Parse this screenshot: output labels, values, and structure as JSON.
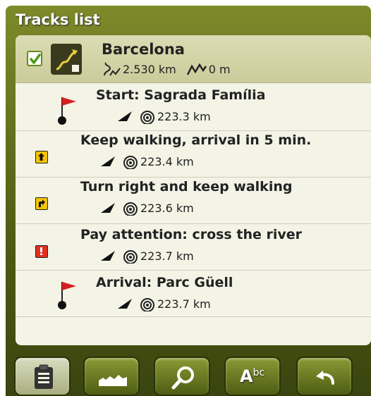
{
  "window": {
    "title": "Tracks list"
  },
  "track": {
    "name": "Barcelona",
    "checked": true,
    "distance": "2.530 km",
    "elevation": "0 m"
  },
  "waypoints": [
    {
      "title": "Start: Sagrada Família",
      "distance": "223.3 km",
      "icon": "red-flag-icon"
    },
    {
      "title": "Keep walking, arrival in 5 min.",
      "distance": "223.4 km",
      "icon": "straight-arrow-sign-icon"
    },
    {
      "title": "Turn right and keep walking",
      "distance": "223.6 km",
      "icon": "right-turn-sign-icon"
    },
    {
      "title": "Pay attention: cross the river",
      "distance": "223.7 km",
      "icon": "warning-sign-icon"
    },
    {
      "title": "Arrival: Parc Güell",
      "distance": "223.7 km",
      "icon": "red-flag-icon"
    }
  ],
  "toolbar": {
    "buttons": [
      {
        "name": "list-button",
        "icon": "clipboard-icon"
      },
      {
        "name": "elevation-profile-button",
        "icon": "elevation-profile-icon"
      },
      {
        "name": "search-button",
        "icon": "magnifier-icon"
      },
      {
        "name": "rename-button",
        "icon": "abc-icon",
        "label": "A",
        "superscript": "bc"
      },
      {
        "name": "back-button",
        "icon": "back-arrow-icon"
      }
    ]
  },
  "colors": {
    "titlebar": "#6b7a1e",
    "panel": "#f3f3e6",
    "selected_row": "#d4d4a8",
    "flag": "#d42020",
    "warning": "#e03020",
    "sign": "#f5c400"
  }
}
